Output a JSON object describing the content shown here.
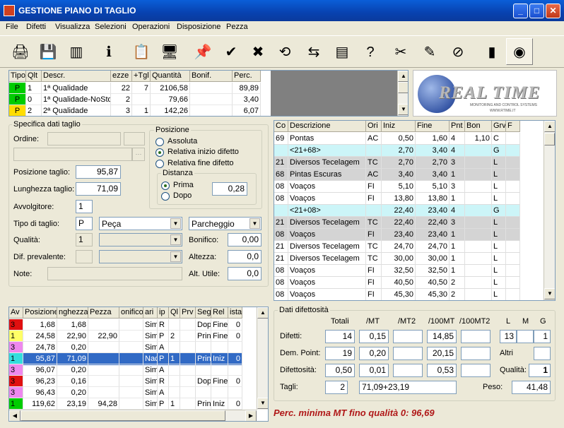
{
  "window": {
    "title": "GESTIONE PIANO DI TAGLIO",
    "min": "_",
    "max": "□",
    "close": "✕"
  },
  "menu": [
    "File",
    "Difetti",
    "Visualizza",
    "Selezioni",
    "Operazioni",
    "Disposizione",
    "Pezza"
  ],
  "toolbar": [
    {
      "icon": "printer-icon",
      "glyph": "🖨"
    },
    {
      "icon": "save-icon",
      "glyph": "💾"
    },
    {
      "icon": "stack-icon",
      "glyph": "▥"
    },
    {
      "icon": "info-icon",
      "glyph": "ℹ"
    },
    {
      "icon": "document-hand-icon",
      "glyph": "📋"
    },
    {
      "icon": "computer-icon",
      "glyph": "🖥"
    },
    {
      "icon": "pushpin-icon",
      "glyph": "📌"
    },
    {
      "icon": "check-icon",
      "glyph": "✔"
    },
    {
      "icon": "cancel-icon",
      "glyph": "✖"
    },
    {
      "icon": "reload-icon",
      "glyph": "⟲"
    },
    {
      "icon": "arrows-icon",
      "glyph": "⇆"
    },
    {
      "icon": "bar-list-icon",
      "glyph": "▤"
    },
    {
      "icon": "help-icon",
      "glyph": "?"
    },
    {
      "icon": "scissors-icon",
      "glyph": "✂"
    },
    {
      "icon": "eraser-icon",
      "glyph": "✎"
    },
    {
      "icon": "no-scissors-icon",
      "glyph": "⊘"
    },
    {
      "icon": "roll-icon",
      "glyph": "▮"
    },
    {
      "icon": "tape-roll-icon",
      "glyph": "◉"
    }
  ],
  "quality_table": {
    "headers": [
      "Tipo",
      "Qlt",
      "Descr.",
      "ezze",
      "+Tgl",
      "Quantità",
      "Bonif.",
      "Perc."
    ],
    "rows": [
      {
        "tipo": "P",
        "color": "#00cc00",
        "qlt": "1",
        "descr": "1ª Qualidade",
        "ezze": "22",
        "tgl": "7",
        "quant": "2106,58",
        "bonif": "",
        "perc": "89,89"
      },
      {
        "tipo": "P",
        "color": "#00cc00",
        "qlt": "0",
        "descr": "1ª Qualidade-NoStd",
        "ezze": "2",
        "tgl": "",
        "quant": "79,66",
        "bonif": "",
        "perc": "3,40"
      },
      {
        "tipo": "P",
        "color": "#ffdd00",
        "qlt": "2",
        "descr": "2ª Qualidade",
        "ezze": "3",
        "tgl": "1",
        "quant": "142,26",
        "bonif": "",
        "perc": "6,07"
      }
    ]
  },
  "logo": {
    "main": "REAL TIME",
    "sub": "MONITORING AND CONTROL SYSTEMS",
    "url": "WWW.RTIME.IT"
  },
  "specifica": {
    "title": "Specifica dati taglio",
    "ordine_label": "Ordine:",
    "posizione_taglio_label": "Posizione taglio:",
    "posizione_taglio": "95,87",
    "lunghezza_label": "Lunghezza taglio:",
    "lunghezza": "71,09",
    "avvolgitore_label": "Avvolgitore:",
    "avvolgitore": "1",
    "tipo_label": "Tipo di taglio:",
    "tipo_code": "P",
    "tipo_value": "Peça",
    "parcheggio": "Parcheggio",
    "qualita_label": "Qualità:",
    "qualita": "1",
    "dif_label": "Dif. prevalente:",
    "note_label": "Note:",
    "bonifico_label": "Bonifico:",
    "bonifico": "0,00",
    "altezza_label": "Altezza:",
    "altezza": "0,0",
    "altutile_label": "Alt. Utile:",
    "altutile": "0,0",
    "posizione": {
      "title": "Posizione",
      "options": [
        "Assoluta",
        "Relativa inizio difetto",
        "Relativa fine difetto"
      ],
      "selected": 1
    },
    "distanza": {
      "title": "Distanza",
      "options": [
        "Prima",
        "Dopo"
      ],
      "selected": 0,
      "value": "0,28"
    }
  },
  "defects": {
    "headers": [
      "Co",
      "Descrizione",
      "Ori",
      "Iniz",
      "Fine",
      "Pnt",
      "Bon",
      "Grv",
      "F"
    ],
    "rows": [
      {
        "co": "69",
        "d": "Pontas",
        "o": "AC",
        "i": "0,50",
        "f": "1,60",
        "p": "4",
        "b": "1,10",
        "g": "C",
        "bg": "#ffffff"
      },
      {
        "co": "",
        "d": "<21+68>",
        "o": "",
        "i": "2,70",
        "f": "3,40",
        "p": "4",
        "b": "",
        "g": "G",
        "bg": "#ccf5f8"
      },
      {
        "co": "21",
        "d": "Diversos Tecelagem",
        "o": "TC",
        "i": "2,70",
        "f": "2,70",
        "p": "3",
        "b": "",
        "g": "L",
        "bg": "#d4d4d4"
      },
      {
        "co": "68",
        "d": "Pintas Escuras",
        "o": "AC",
        "i": "3,40",
        "f": "3,40",
        "p": "1",
        "b": "",
        "g": "L",
        "bg": "#d4d4d4"
      },
      {
        "co": "08",
        "d": "Voaços",
        "o": "FI",
        "i": "5,10",
        "f": "5,10",
        "p": "3",
        "b": "",
        "g": "L",
        "bg": "#ffffff"
      },
      {
        "co": "08",
        "d": "Voaços",
        "o": "FI",
        "i": "13,80",
        "f": "13,80",
        "p": "1",
        "b": "",
        "g": "L",
        "bg": "#ffffff"
      },
      {
        "co": "",
        "d": "<21+08>",
        "o": "",
        "i": "22,40",
        "f": "23,40",
        "p": "4",
        "b": "",
        "g": "G",
        "bg": "#ccf5f8"
      },
      {
        "co": "21",
        "d": "Diversos Tecelagem",
        "o": "TC",
        "i": "22,40",
        "f": "22,40",
        "p": "3",
        "b": "",
        "g": "L",
        "bg": "#d4d4d4"
      },
      {
        "co": "08",
        "d": "Voaços",
        "o": "FI",
        "i": "23,40",
        "f": "23,40",
        "p": "1",
        "b": "",
        "g": "L",
        "bg": "#d4d4d4"
      },
      {
        "co": "21",
        "d": "Diversos Tecelagem",
        "o": "TC",
        "i": "24,70",
        "f": "24,70",
        "p": "1",
        "b": "",
        "g": "L",
        "bg": "#ffffff"
      },
      {
        "co": "21",
        "d": "Diversos Tecelagem",
        "o": "TC",
        "i": "30,00",
        "f": "30,00",
        "p": "1",
        "b": "",
        "g": "L",
        "bg": "#ffffff"
      },
      {
        "co": "08",
        "d": "Voaços",
        "o": "FI",
        "i": "32,50",
        "f": "32,50",
        "p": "1",
        "b": "",
        "g": "L",
        "bg": "#ffffff"
      },
      {
        "co": "08",
        "d": "Voaços",
        "o": "FI",
        "i": "40,50",
        "f": "40,50",
        "p": "2",
        "b": "",
        "g": "L",
        "bg": "#ffffff"
      },
      {
        "co": "08",
        "d": "Voaços",
        "o": "FI",
        "i": "45,30",
        "f": "45,30",
        "p": "2",
        "b": "",
        "g": "L",
        "bg": "#ffffff"
      }
    ]
  },
  "cuts": {
    "headers": [
      "Av",
      "Posizione",
      "nghezza",
      "Pezza",
      "onifico",
      "ari",
      "ip",
      "Ql",
      "Prv",
      "Seg",
      "Rel",
      "ista"
    ],
    "rows": [
      {
        "av": "3",
        "avc": "#e01010",
        "pos": "1,68",
        "lun": "1,68",
        "pez": "",
        "bon": "",
        "var": "Sim",
        "tip": "R",
        "ql": "",
        "prv": "",
        "seg": "Dop",
        "rel": "Fine",
        "ist": "0",
        "sel": false
      },
      {
        "av": "1",
        "avc": "#ffff66",
        "pos": "24,58",
        "lun": "22,90",
        "pez": "22,90",
        "bon": "",
        "var": "Sim",
        "tip": "P",
        "ql": "2",
        "prv": "",
        "seg": "Prin",
        "rel": "Fine",
        "ist": "0",
        "sel": false
      },
      {
        "av": "3",
        "avc": "#ee88ee",
        "pos": "24,78",
        "lun": "0,20",
        "pez": "",
        "bon": "",
        "var": "Sim",
        "tip": "A",
        "ql": "",
        "prv": "",
        "seg": "",
        "rel": "",
        "ist": "",
        "sel": false
      },
      {
        "av": "1",
        "avc": "#33dddd",
        "pos": "95,87",
        "lun": "71,09",
        "pez": "",
        "bon": "",
        "var": "Nac",
        "tip": "P",
        "ql": "1",
        "prv": "",
        "seg": "Prin",
        "rel": "Iniz",
        "ist": "0",
        "sel": true
      },
      {
        "av": "3",
        "avc": "#ee88ee",
        "pos": "96,07",
        "lun": "0,20",
        "pez": "",
        "bon": "",
        "var": "Sim",
        "tip": "A",
        "ql": "",
        "prv": "",
        "seg": "",
        "rel": "",
        "ist": "",
        "sel": false
      },
      {
        "av": "3",
        "avc": "#e01010",
        "pos": "96,23",
        "lun": "0,16",
        "pez": "",
        "bon": "",
        "var": "Sim",
        "tip": "R",
        "ql": "",
        "prv": "",
        "seg": "Dop",
        "rel": "Fine",
        "ist": "0",
        "sel": false
      },
      {
        "av": "3",
        "avc": "#ee88ee",
        "pos": "96,43",
        "lun": "0,20",
        "pez": "",
        "bon": "",
        "var": "Sim",
        "tip": "A",
        "ql": "",
        "prv": "",
        "seg": "",
        "rel": "",
        "ist": "",
        "sel": false
      },
      {
        "av": "1",
        "avc": "#00cc00",
        "pos": "119,62",
        "lun": "23,19",
        "pez": "94,28",
        "bon": "",
        "var": "Sim",
        "tip": "P",
        "ql": "1",
        "prv": "",
        "seg": "Prin",
        "rel": "Iniz",
        "ist": "0",
        "sel": false
      }
    ]
  },
  "difettosita": {
    "title": "Dati difettosità",
    "col_headers": [
      "Totali",
      "/MT",
      "/MT2",
      "/100MT",
      "/100MT2"
    ],
    "lmg_headers": [
      "L",
      "M",
      "G"
    ],
    "difetti_label": "Difetti:",
    "difetti": [
      "14",
      "0,15",
      "",
      "14,85",
      ""
    ],
    "lmg": [
      "13",
      "",
      "1"
    ],
    "dem_label": "Dem. Point:",
    "dem": [
      "19",
      "0,20",
      "",
      "20,15",
      ""
    ],
    "altri_label": "Altri",
    "altri": "",
    "difettosita_label": "Difettosità:",
    "dif": [
      "0,50",
      "0,01",
      "",
      "0,53",
      ""
    ],
    "qualita_label": "Qualità:",
    "qualita": "1",
    "tagli_label": "Tagli:",
    "tagli": "2",
    "tagli_desc": "71,09+23,19",
    "peso_label": "Peso:",
    "peso": "41,48"
  },
  "status": "Perc. minima MT fino qualità 0: 96,69"
}
